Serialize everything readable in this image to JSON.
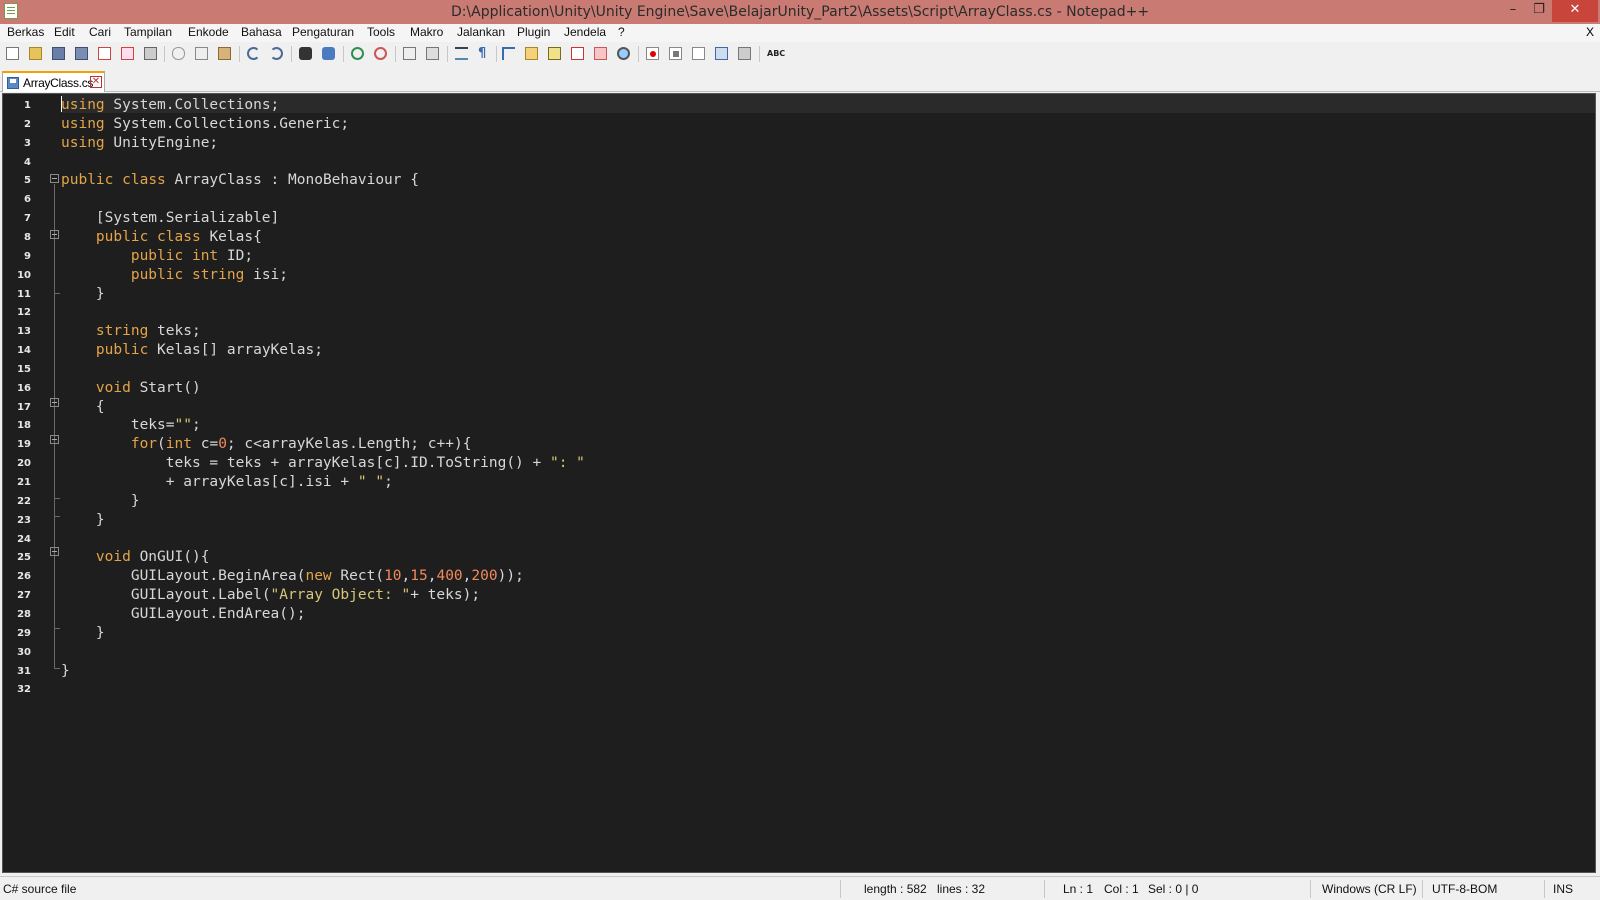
{
  "window": {
    "title": "D:\\Application\\Unity\\Unity Engine\\Save\\BelajarUnity_Part2\\Assets\\Script\\ArrayClass.cs - Notepad++",
    "minimize": "–",
    "restore": "❐",
    "close": "✕"
  },
  "menu": {
    "items": [
      "Berkas",
      "Edit",
      "Cari",
      "Tampilan",
      "Enkode",
      "Bahasa",
      "Pengaturan",
      "Tools",
      "Makro",
      "Jalankan",
      "Plugin",
      "Jendela",
      "?"
    ],
    "close_doc": "X"
  },
  "toolbar": {
    "icons": [
      "new-file-icon",
      "open-file-icon",
      "save-icon",
      "save-all-icon",
      "close-icon",
      "close-all-icon",
      "print-icon",
      "cut-icon",
      "copy-icon",
      "paste-icon",
      "undo-icon",
      "redo-icon",
      "find-icon",
      "replace-icon",
      "zoom-in-icon",
      "zoom-out-icon",
      "sync-vertical-icon",
      "sync-horizontal-icon",
      "word-wrap-icon",
      "show-all-characters-icon",
      "indent-guide-icon",
      "user-defined-language-icon",
      "document-map-icon",
      "function-list-icon",
      "folder-as-workspace-icon",
      "monitoring-icon",
      "record-macro-icon",
      "stop-macro-icon",
      "play-macro-icon",
      "run-macro-multiple-icon",
      "save-macro-icon",
      "spell-check-icon"
    ]
  },
  "tab": {
    "label": "ArrayClass.cs",
    "close": "✕"
  },
  "editor": {
    "line_numbers": [
      "1",
      "2",
      "3",
      "4",
      "5",
      "6",
      "7",
      "8",
      "9",
      "10",
      "11",
      "12",
      "13",
      "14",
      "15",
      "16",
      "17",
      "18",
      "19",
      "20",
      "21",
      "22",
      "23",
      "24",
      "25",
      "26",
      "27",
      "28",
      "29",
      "30",
      "31",
      "32"
    ],
    "lines": [
      "using System.Collections;",
      "using System.Collections.Generic;",
      "using UnityEngine;",
      "",
      "public class ArrayClass : MonoBehaviour {",
      "",
      "    [System.Serializable]",
      "    public class Kelas{",
      "        public int ID;",
      "        public string isi;",
      "    }",
      "",
      "    string teks;",
      "    public Kelas[] arrayKelas;",
      "",
      "    void Start()",
      "    {",
      "        teks=\"\";",
      "        for(int c=0; c<arrayKelas.Length; c++){",
      "            teks = teks + arrayKelas[c].ID.ToString() + \": \"",
      "            + arrayKelas[c].isi + \" \";",
      "        }",
      "    }",
      "",
      "    void OnGUI(){",
      "        GUILayout.BeginArea(new Rect(10,15,400,200));",
      "        GUILayout.Label(\"Array Object: \"+ teks);",
      "        GUILayout.EndArea();",
      "    }",
      "",
      "}",
      ""
    ],
    "keywords": [
      "using",
      "public",
      "class",
      "int",
      "string",
      "void",
      "for",
      "new"
    ]
  },
  "status": {
    "file_type": "C# source file",
    "length": "length : 582",
    "lines": "lines : 32",
    "ln": "Ln : 1",
    "col": "Col : 1",
    "sel": "Sel : 0 | 0",
    "eol": "Windows (CR LF)",
    "encoding": "UTF-8-BOM",
    "mode": "INS"
  },
  "colors": {
    "titlebar": "#c97b73",
    "editor_bg": "#1e1e1e",
    "keyword": "#e3a449",
    "string": "#d6c57b",
    "number": "#f08a5d",
    "text": "#d7d7d7"
  }
}
